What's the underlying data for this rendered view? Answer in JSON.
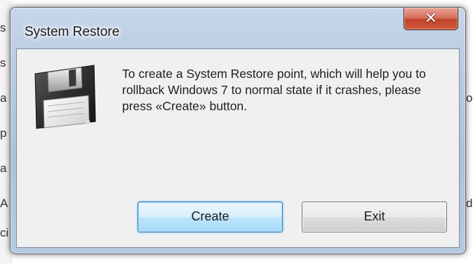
{
  "background": {
    "left_chars": [
      "s",
      "s",
      "a",
      "p",
      "a",
      "A",
      "ci"
    ],
    "right_chars": [
      "o",
      "d"
    ]
  },
  "window": {
    "title": "System Restore",
    "close_glyph": "✕",
    "icon": "floppy-disk-icon",
    "message": "To create a System Restore point, which will help you to rollback Windows 7 to normal state if it crashes, please press «Create» button.",
    "buttons": {
      "create": "Create",
      "exit": "Exit"
    }
  },
  "colors": {
    "frame": "#b7c9df",
    "close": "#c2412b",
    "client": "#f0f0f0",
    "default_button_border": "#3c7fb1"
  }
}
